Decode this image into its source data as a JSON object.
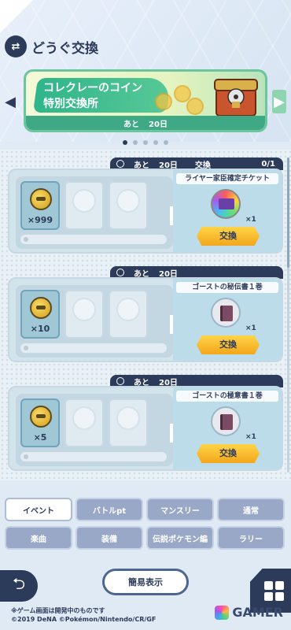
{
  "header": {
    "icon_name": "exchange-icon",
    "icon_glyph": "⇄",
    "title": "どうぐ交換"
  },
  "banner": {
    "title_line1": "コレクレーのコイン",
    "title_line2": "特別交換所",
    "time_prefix": "あと",
    "time_value": "20日",
    "npc_icon": "gimmighoul-chest-icon",
    "prev_glyph": "◀",
    "next_glyph": "▶"
  },
  "pager": {
    "count": 5,
    "active_index": 0
  },
  "cards": [
    {
      "header_prefix": "あと",
      "header_days": "20日",
      "swap_label": "交換",
      "swap_count": "0/1",
      "cost_qty": "×999",
      "reward_name": "ライヤー家臣確定チケット",
      "reward_qty": "×1",
      "reward_icon": "rainbow-ticket-icon",
      "button": "交換"
    },
    {
      "header_prefix": "あと",
      "header_days": "20日",
      "swap_label": "",
      "swap_count": "",
      "cost_qty": "×10",
      "reward_name": "ゴーストの秘伝書１巻",
      "reward_qty": "×1",
      "reward_icon": "book-icon",
      "button": "交換"
    },
    {
      "header_prefix": "あと",
      "header_days": "20日",
      "swap_label": "",
      "swap_count": "",
      "cost_qty": "×5",
      "reward_name": "ゴーストの極意書１巻",
      "reward_qty": "×1",
      "reward_icon": "book-icon",
      "button": "交換"
    }
  ],
  "tabs": [
    [
      "イベント",
      "バトルpt",
      "マンスリー",
      "通常"
    ],
    [
      "楽曲",
      "装備",
      "伝説ポケモン編",
      "ラリー"
    ]
  ],
  "tabs_active": "イベント",
  "bottom": {
    "back_glyph": "⮌",
    "simple_label": "簡易表示",
    "notice": "※ゲーム画面は開発中のものです",
    "copyright": "©2019 DeNA ©Pokémon/Nintendo/CR/GF",
    "watermark": "GAMER"
  }
}
